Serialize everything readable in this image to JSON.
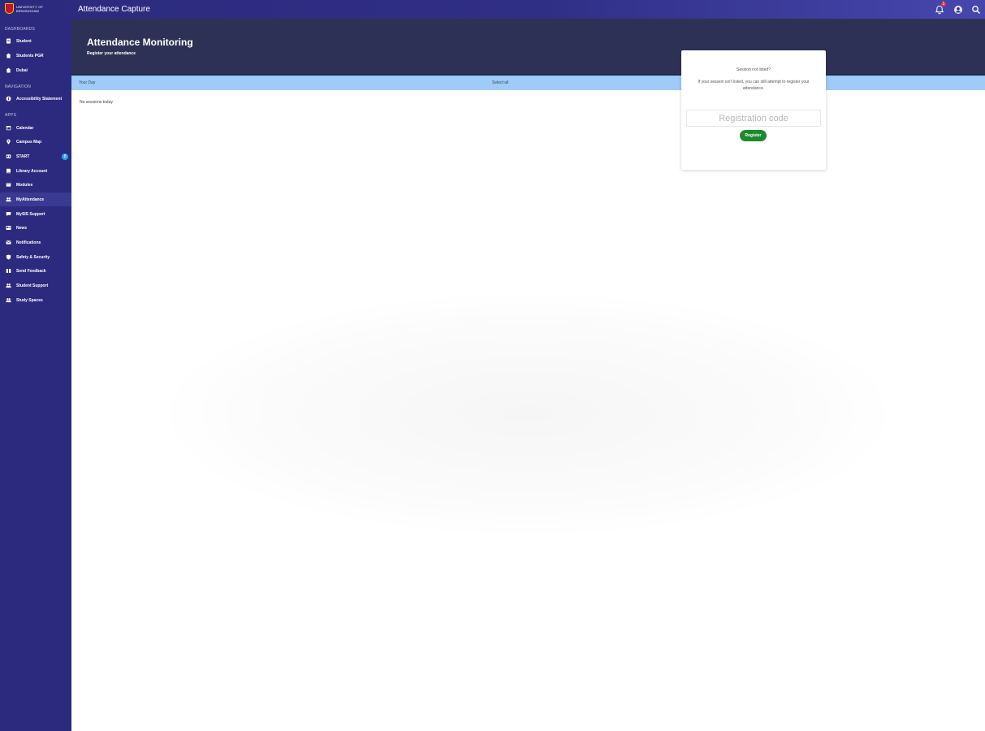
{
  "header": {
    "logo_line1": "UNIVERSITY OF",
    "logo_line2": "BIRMINGHAM",
    "app_title": "Attendance Capture",
    "notification_count": "1"
  },
  "sidebar": {
    "sections": {
      "dashboards": "DASHBOARDS",
      "navigation": "NAVIGATION",
      "apps": "APPS"
    },
    "dashboards": [
      {
        "label": "Student",
        "icon": "document-icon"
      },
      {
        "label": "Students PGR",
        "icon": "home-icon"
      },
      {
        "label": "Dubai",
        "icon": "home-icon"
      }
    ],
    "navigation": [
      {
        "label": "Accessibility Statement",
        "icon": "accessibility-icon"
      }
    ],
    "apps": [
      {
        "label": "Calendar",
        "icon": "calendar-icon"
      },
      {
        "label": "Campus Map",
        "icon": "map-pin-icon"
      },
      {
        "label": "START",
        "icon": "start-icon",
        "badge": "8"
      },
      {
        "label": "Library Account",
        "icon": "book-icon"
      },
      {
        "label": "Modules",
        "icon": "modules-icon"
      },
      {
        "label": "MyAttendance",
        "icon": "people-icon",
        "active": true
      },
      {
        "label": "MySIS Support",
        "icon": "chat-icon"
      },
      {
        "label": "News",
        "icon": "news-icon"
      },
      {
        "label": "Notifications",
        "icon": "mail-icon"
      },
      {
        "label": "Safety & Security",
        "icon": "shield-icon"
      },
      {
        "label": "Send Feedback",
        "icon": "feedback-icon"
      },
      {
        "label": "Student Support",
        "icon": "people-icon"
      },
      {
        "label": "Study Spaces",
        "icon": "people-icon"
      }
    ]
  },
  "hero": {
    "title": "Attendance Monitoring",
    "subtitle": "Register your attendance"
  },
  "table": {
    "col_day": "Your Day",
    "col_action": "Select all",
    "empty_message": "No sessions today"
  },
  "register_card": {
    "title": "Session not listed?",
    "description": "If your session isn't listed, you can still attempt to register your attendance.",
    "input_placeholder": "Registration code",
    "button_label": "Register"
  },
  "colors": {
    "sidebar_bg": "#2b2a7e",
    "hero_bg": "#2e3156",
    "table_head_bg": "#9ecbf7",
    "register_button": "#1e8a2e",
    "badge_blue": "#29a3e6",
    "badge_red": "#e53935"
  }
}
